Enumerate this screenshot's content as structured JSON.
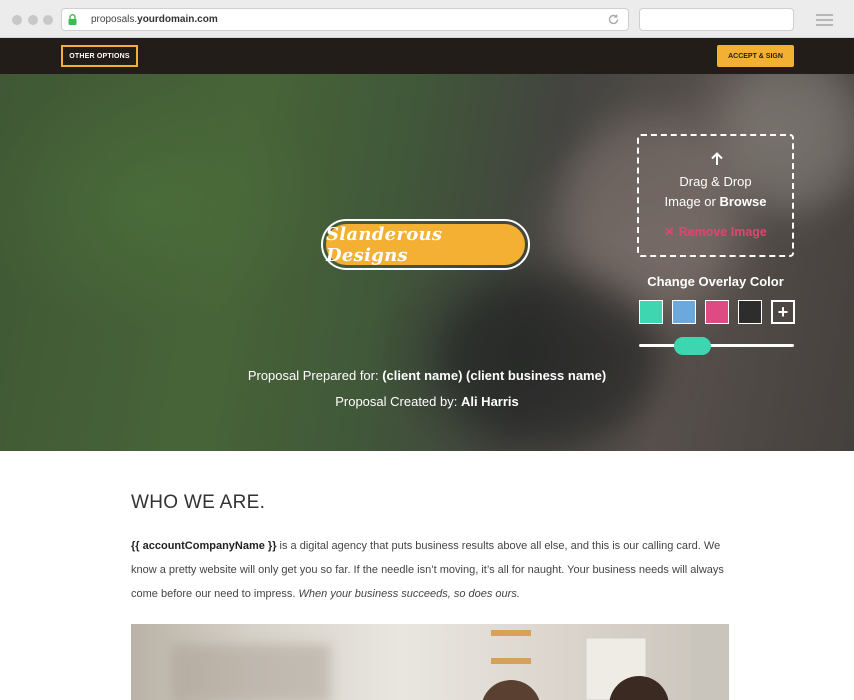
{
  "browser": {
    "url_prefix": "proposals.",
    "url_domain": "yourdomain.com"
  },
  "header": {
    "other_options": "OTHER OPTIONS",
    "accept_sign": "ACCEPT & SIGN"
  },
  "hero": {
    "logo_text": "Slanderous Designs",
    "dropzone": {
      "line1": "Drag & Drop",
      "line2_prefix": "Image or ",
      "line2_link": "Browse",
      "remove_label": "Remove Image"
    },
    "overlay_label": "Change Overlay Color",
    "swatches": [
      "#3ed6b0",
      "#6aa8dd",
      "#de4b82",
      "#2d2d2d"
    ],
    "add_swatch_symbol": "+",
    "prepared_for_label": "Proposal Prepared for: ",
    "prepared_for_value": "(client name) (client business name)",
    "created_by_label": "Proposal Created by: ",
    "created_by_value": "Ali Harris"
  },
  "content": {
    "heading": "WHO WE ARE.",
    "para_token": "{{ accountCompanyName }}",
    "para_body": " is a digital agency that puts business results above all else, and this is our calling card. We know a pretty website will only get you so far. If the needle isn’t moving, it’s all for naught. Your business needs will always come before our need to impress. ",
    "para_italic": "When your business succeeds, so does ours."
  },
  "colors": {
    "accent": "#f4b033",
    "topbar": "#231d1a",
    "remove": "#e0456f"
  }
}
